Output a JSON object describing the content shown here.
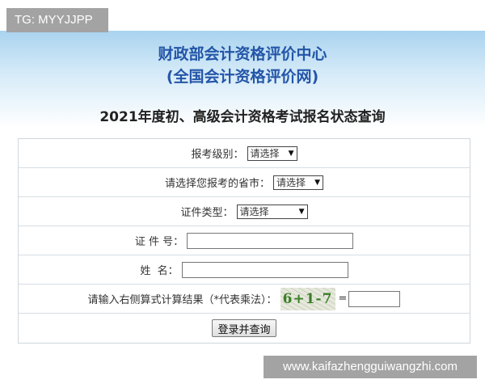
{
  "tag_label": "TG: MYYJJPP",
  "header": {
    "org_line1": "财政部会计资格评价中心",
    "org_line2": "(全国会计资格评价网)",
    "page_title": "2021年度初、高级会计资格考试报名状态查询"
  },
  "form": {
    "level": {
      "label": "报考级别：",
      "value": "请选择"
    },
    "province": {
      "label": "请选择您报考的省市：",
      "value": "请选择"
    },
    "id_type": {
      "label": "证件类型：",
      "value": "请选择"
    },
    "id_number": {
      "label": "证 件 号：",
      "value": ""
    },
    "name": {
      "label": "姓  名：",
      "value": ""
    },
    "captcha": {
      "label": "请输入右侧算式计算结果（*代表乘法）：",
      "image_text": "6+1-7",
      "equals": "=",
      "value": ""
    },
    "submit_label": "登录并查询"
  },
  "watermark": "www.kaifazhengguiwangzhi.com",
  "colors": {
    "title_blue": "#2456a8",
    "header_gradient_top": "#a9d3ef"
  }
}
